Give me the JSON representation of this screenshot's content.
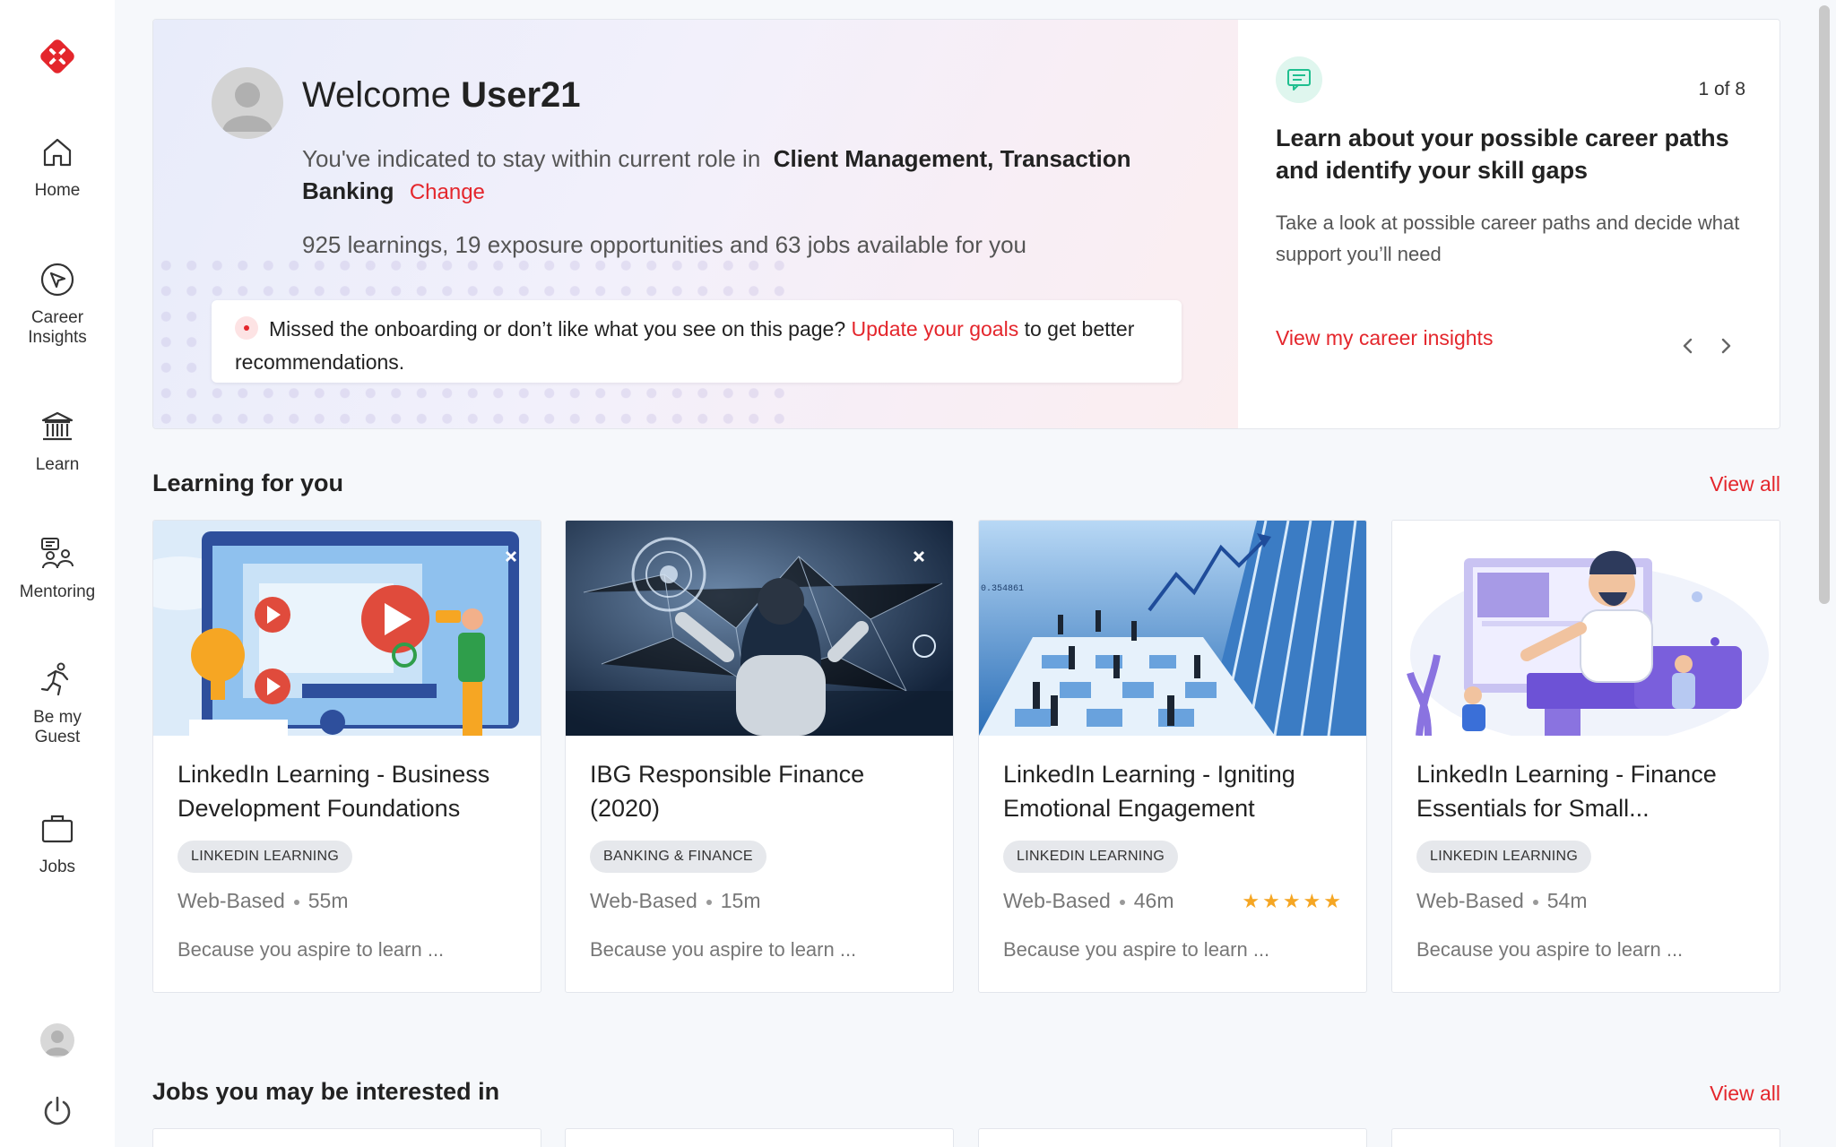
{
  "sidebar": {
    "items": [
      {
        "label": "Home",
        "icon": "home-icon"
      },
      {
        "label": "Career Insights",
        "icon": "compass-icon"
      },
      {
        "label": "Learn",
        "icon": "bank-icon"
      },
      {
        "label": "Mentoring",
        "icon": "mentoring-icon"
      },
      {
        "label": "Be my Guest",
        "icon": "running-person-icon"
      },
      {
        "label": "Jobs",
        "icon": "briefcase-icon"
      }
    ]
  },
  "hero": {
    "welcome_prefix": "Welcome",
    "user_name": "User21",
    "role_prefix": "You've indicated to stay within current role in",
    "role_value": "Client Management, Transaction Banking",
    "change_label": "Change",
    "availability": "925 learnings, 19 exposure opportunities and 63 jobs available for you",
    "notice_text": "Missed the onboarding or don’t like what you see on this page?",
    "notice_link": "Update your goals",
    "notice_suffix": "to get better recommendations."
  },
  "insights": {
    "pager": "1 of 8",
    "title": "Learn about your possible career paths and identify your skill gaps",
    "description": "Take a look at possible career paths and decide what support you’ll need",
    "link": "View my career insights"
  },
  "learning": {
    "title": "Learning for you",
    "view_all": "View all",
    "cards": [
      {
        "title": "LinkedIn Learning - Business Development Foundations",
        "tag": "LINKEDIN LEARNING",
        "format": "Web-Based",
        "duration": "55m",
        "reason": "Because you aspire to learn ..."
      },
      {
        "title": "IBG Responsible Finance (2020)",
        "tag": "BANKING & FINANCE",
        "format": "Web-Based",
        "duration": "15m",
        "reason": "Because you aspire to learn ..."
      },
      {
        "title": "LinkedIn Learning - Igniting Emotional Engagement",
        "tag": "LINKEDIN LEARNING",
        "format": "Web-Based",
        "duration": "46m",
        "rating": "★★★★★",
        "reason": "Because you aspire to learn ..."
      },
      {
        "title": "LinkedIn Learning - Finance Essentials for Small...",
        "tag": "LINKEDIN LEARNING",
        "format": "Web-Based",
        "duration": "54m",
        "reason": "Because you aspire to learn ..."
      }
    ]
  },
  "jobs": {
    "title": "Jobs you may be interested in",
    "view_all": "View all"
  },
  "colors": {
    "accent": "#e4262c",
    "star": "#f5a623",
    "mint": "#1fbf8f"
  }
}
